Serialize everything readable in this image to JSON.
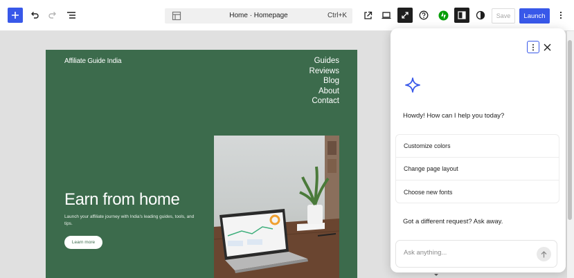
{
  "toolbar": {
    "document_title": "Home · Homepage",
    "shortcut": "Ctrl+K",
    "save_label": "Save",
    "launch_label": "Launch",
    "icons": [
      "plus-icon",
      "undo-icon",
      "redo-icon",
      "list-view-icon",
      "template-icon",
      "external-link-icon",
      "desktop-icon",
      "zoom-out-icon",
      "help-icon",
      "jetpack-icon",
      "sidebar-icon",
      "styles-icon",
      "more-vertical-icon"
    ],
    "accent": "#3858e9"
  },
  "site": {
    "title": "Affiliate Guide India",
    "nav": [
      "Guides",
      "Reviews",
      "Blog",
      "About",
      "Contact"
    ],
    "hero_heading": "Earn from home",
    "hero_text": "Launch your affiliate journey with India's leading guides, tools, and tips.",
    "cta_label": "Learn more",
    "bg_color": "#3c6b4c"
  },
  "assistant": {
    "greeting": "Howdy! How can I help you today?",
    "suggestions": [
      "Customize colors",
      "Change page layout",
      "Choose new fonts"
    ],
    "prompt": "Got a different request? Ask away.",
    "input_placeholder": "Ask anything..."
  }
}
